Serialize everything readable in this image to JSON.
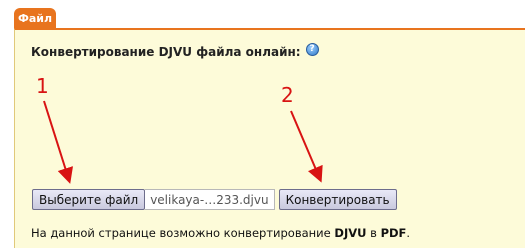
{
  "tab": {
    "label": "Файл"
  },
  "title": "Конвертирование DJVU файла онлайн:",
  "help_icon": {
    "glyph": "?",
    "name": "help-icon"
  },
  "annotations": {
    "one": "1",
    "two": "2",
    "color": "#d81313"
  },
  "file_input": {
    "button_label": "Выберите файл",
    "selected_file": "velikaya-…233.djvu"
  },
  "convert_button": {
    "label": "Конвертировать"
  },
  "note": {
    "prefix": "На данной странице возможно конвертирование ",
    "from": "DJVU",
    "middle": " в ",
    "to": "PDF",
    "suffix": "."
  },
  "colors": {
    "accent": "#e8741e",
    "panel_bg": "#fdfbd9"
  }
}
